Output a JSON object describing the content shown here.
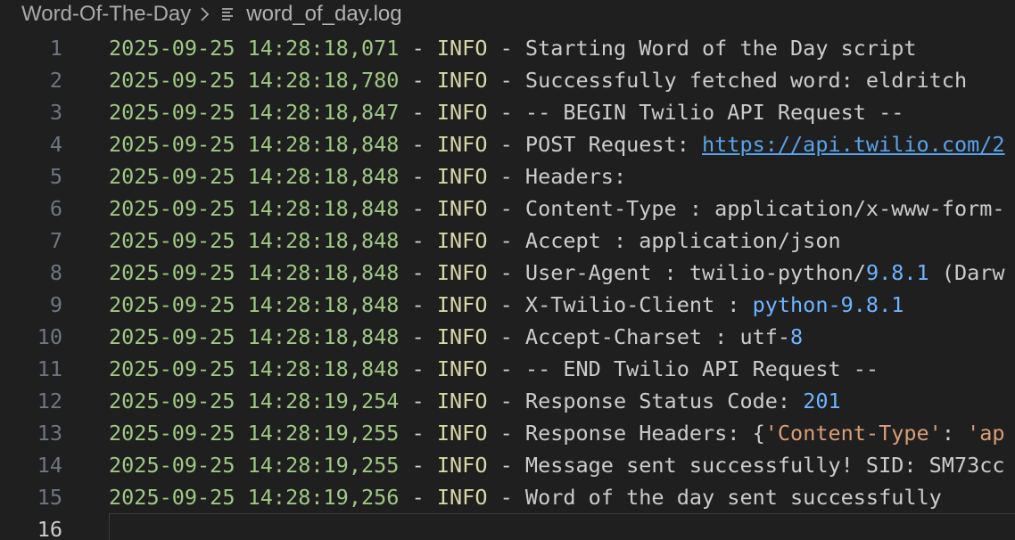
{
  "breadcrumb": {
    "folder": "Word-Of-The-Day",
    "file": "word_of_day.log"
  },
  "lines": [
    {
      "n": "1",
      "ts": "2025-09-25 14:28:18,071",
      "sep1": " - ",
      "lvl": "INFO",
      "sep2": " - ",
      "msg": "Starting Word of the Day script"
    },
    {
      "n": "2",
      "ts": "2025-09-25 14:28:18,780",
      "sep1": " - ",
      "lvl": "INFO",
      "sep2": " - ",
      "msg": "Successfully fetched word: eldritch"
    },
    {
      "n": "3",
      "ts": "2025-09-25 14:28:18,847",
      "sep1": " - ",
      "lvl": "INFO",
      "sep2": " - ",
      "msg": "-- BEGIN Twilio API Request --"
    },
    {
      "n": "4",
      "ts": "2025-09-25 14:28:18,848",
      "sep1": " - ",
      "lvl": "INFO",
      "sep2": " - ",
      "msg": "POST Request: ",
      "link": "https://api.twilio.com/2"
    },
    {
      "n": "5",
      "ts": "2025-09-25 14:28:18,848",
      "sep1": " - ",
      "lvl": "INFO",
      "sep2": " - ",
      "msg": "Headers:"
    },
    {
      "n": "6",
      "ts": "2025-09-25 14:28:18,848",
      "sep1": " - ",
      "lvl": "INFO",
      "sep2": " - ",
      "msg": "Content-Type : application/x-www-form-"
    },
    {
      "n": "7",
      "ts": "2025-09-25 14:28:18,848",
      "sep1": " - ",
      "lvl": "INFO",
      "sep2": " - ",
      "msg": "Accept : application/json"
    },
    {
      "n": "8",
      "ts": "2025-09-25 14:28:18,848",
      "sep1": " - ",
      "lvl": "INFO",
      "sep2": " - ",
      "msg": "User-Agent : twilio-python/",
      "num": "9.8.1",
      "tail": " (Darw"
    },
    {
      "n": "9",
      "ts": "2025-09-25 14:28:18,848",
      "sep1": " - ",
      "lvl": "INFO",
      "sep2": " - ",
      "msg": "X-Twilio-Client : ",
      "num": "python-9.8.1"
    },
    {
      "n": "10",
      "ts": "2025-09-25 14:28:18,848",
      "sep1": " - ",
      "lvl": "INFO",
      "sep2": " - ",
      "msg": "Accept-Charset : utf-",
      "num": "8"
    },
    {
      "n": "11",
      "ts": "2025-09-25 14:28:18,848",
      "sep1": " - ",
      "lvl": "INFO",
      "sep2": " - ",
      "msg": "-- END Twilio API Request --"
    },
    {
      "n": "12",
      "ts": "2025-09-25 14:28:19,254",
      "sep1": " - ",
      "lvl": "INFO",
      "sep2": " - ",
      "msg": "Response Status Code: ",
      "num": "201"
    },
    {
      "n": "13",
      "ts": "2025-09-25 14:28:19,255",
      "sep1": " - ",
      "lvl": "INFO",
      "sep2": " - ",
      "msg": "Response Headers: {",
      "str": "'Content-Type'",
      "tail": ": ",
      "str2": "'ap"
    },
    {
      "n": "14",
      "ts": "2025-09-25 14:28:19,255",
      "sep1": " - ",
      "lvl": "INFO",
      "sep2": " - ",
      "msg": "Message sent successfully! SID: SM73cc"
    },
    {
      "n": "15",
      "ts": "2025-09-25 14:28:19,256",
      "sep1": " - ",
      "lvl": "INFO",
      "sep2": " - ",
      "msg": "Word of the day sent successfully"
    },
    {
      "n": "16",
      "ts": "",
      "sep1": "",
      "lvl": "",
      "sep2": "",
      "msg": ""
    }
  ]
}
